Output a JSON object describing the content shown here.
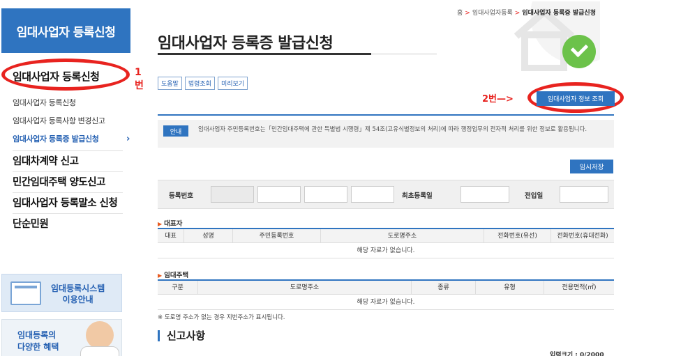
{
  "sidebar": {
    "header": "임대사업자 등록신청",
    "main_item": "임대사업자 등록신청",
    "annotation": "1번",
    "sub_items": [
      "임대사업자 등록신청",
      "임대사업자 등록사항 변경신고",
      "임대사업자 등록증 발급신청"
    ],
    "active_chevron": "›",
    "menu": [
      "임대차계약 신고",
      "민간임대주택 양도신고",
      "임대사업자 등록말소 신청",
      "단순민원"
    ],
    "banner1": [
      "임대등록시스템",
      "이용안내"
    ],
    "banner2": [
      "임대등록의",
      "다양한 혜택"
    ]
  },
  "breadcrumb": {
    "home": "홈",
    "sep": ">",
    "level1": "임대사업자등록",
    "current": "임대사업자 등록증 발급신청"
  },
  "page_title": "임대사업자 등록증 발급신청",
  "toolbar": [
    "도움말",
    "법령조회",
    "미리보기"
  ],
  "annotation2": "2번—>",
  "info_button": "임대사업자 정보 조회",
  "notice": {
    "label": "안내",
    "text": "임대사업자 주민등록번호는「민간임대주택에 관한 특별법 시행령」제 54조(고유식별정보의 처리)에 따라 행정업무의 전자적 처리를 위한 정보로 활용됩니다."
  },
  "save_button": "임시저장",
  "registration": {
    "reg_no_label": "등록번호",
    "first_reg_label": "최초등록일",
    "move_in_label": "전입일"
  },
  "representative": {
    "title": "대표자",
    "columns": [
      "대표",
      "성명",
      "주민등록번호",
      "도로명주소",
      "전화번호(유선)",
      "전화번호(휴대전화)"
    ],
    "empty": "해당 자료가 없습니다."
  },
  "rental_house": {
    "title": "임대주택",
    "columns": [
      "구분",
      "도로명주소",
      "종류",
      "유형",
      "전용면적(㎡)"
    ],
    "empty": "해당 자료가 없습니다."
  },
  "note": "※ 도로명 주소가 없는 경우 지번주소가 표시됩니다.",
  "report_section_title": "신고사항",
  "input_size": "입력크기 : 0/2000",
  "colors": {
    "primary": "#2f74c0",
    "annotation": "#e8231f",
    "check": "#6cc24a"
  }
}
